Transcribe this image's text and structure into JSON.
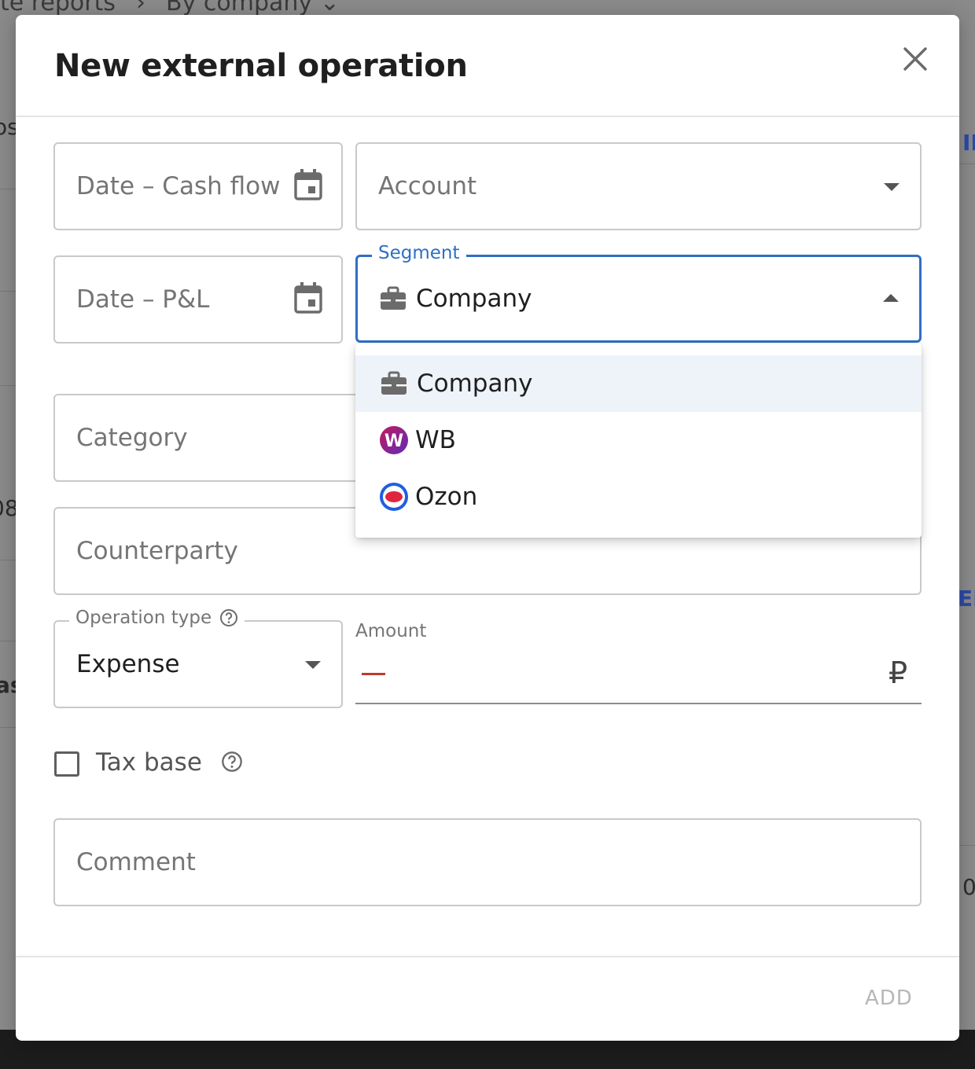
{
  "background": {
    "breadcrumb": [
      "te reports",
      "By company"
    ],
    "fragments": [
      "os",
      "08",
      "as",
      "II",
      "EF",
      "0"
    ]
  },
  "modal": {
    "title": "New external operation",
    "add_label": "ADD"
  },
  "fields": {
    "date_cash_flow": {
      "placeholder": "Date – Cash flow"
    },
    "account": {
      "placeholder": "Account"
    },
    "date_pl": {
      "placeholder": "Date – P&L"
    },
    "segment": {
      "label": "Segment",
      "value": "Company"
    },
    "category": {
      "placeholder": "Category"
    },
    "counterparty": {
      "placeholder": "Counterparty"
    },
    "operation_type": {
      "label": "Operation type",
      "value": "Expense"
    },
    "amount": {
      "label": "Amount",
      "sign": "–",
      "currency": "₽"
    },
    "tax_base": {
      "label": "Tax base",
      "checked": false
    },
    "comment": {
      "placeholder": "Comment"
    }
  },
  "segment_options": [
    {
      "label": "Company",
      "icon": "briefcase-icon",
      "selected": true
    },
    {
      "label": "WB",
      "icon": "wb-logo-icon",
      "selected": false
    },
    {
      "label": "Ozon",
      "icon": "ozon-logo-icon",
      "selected": false
    }
  ],
  "colors": {
    "accent": "#2f6fc6",
    "selected_option_bg": "#eef3fa",
    "minus": "#c0392b",
    "wb": "#7b2fbf",
    "ozon": "#1f5fe0"
  }
}
